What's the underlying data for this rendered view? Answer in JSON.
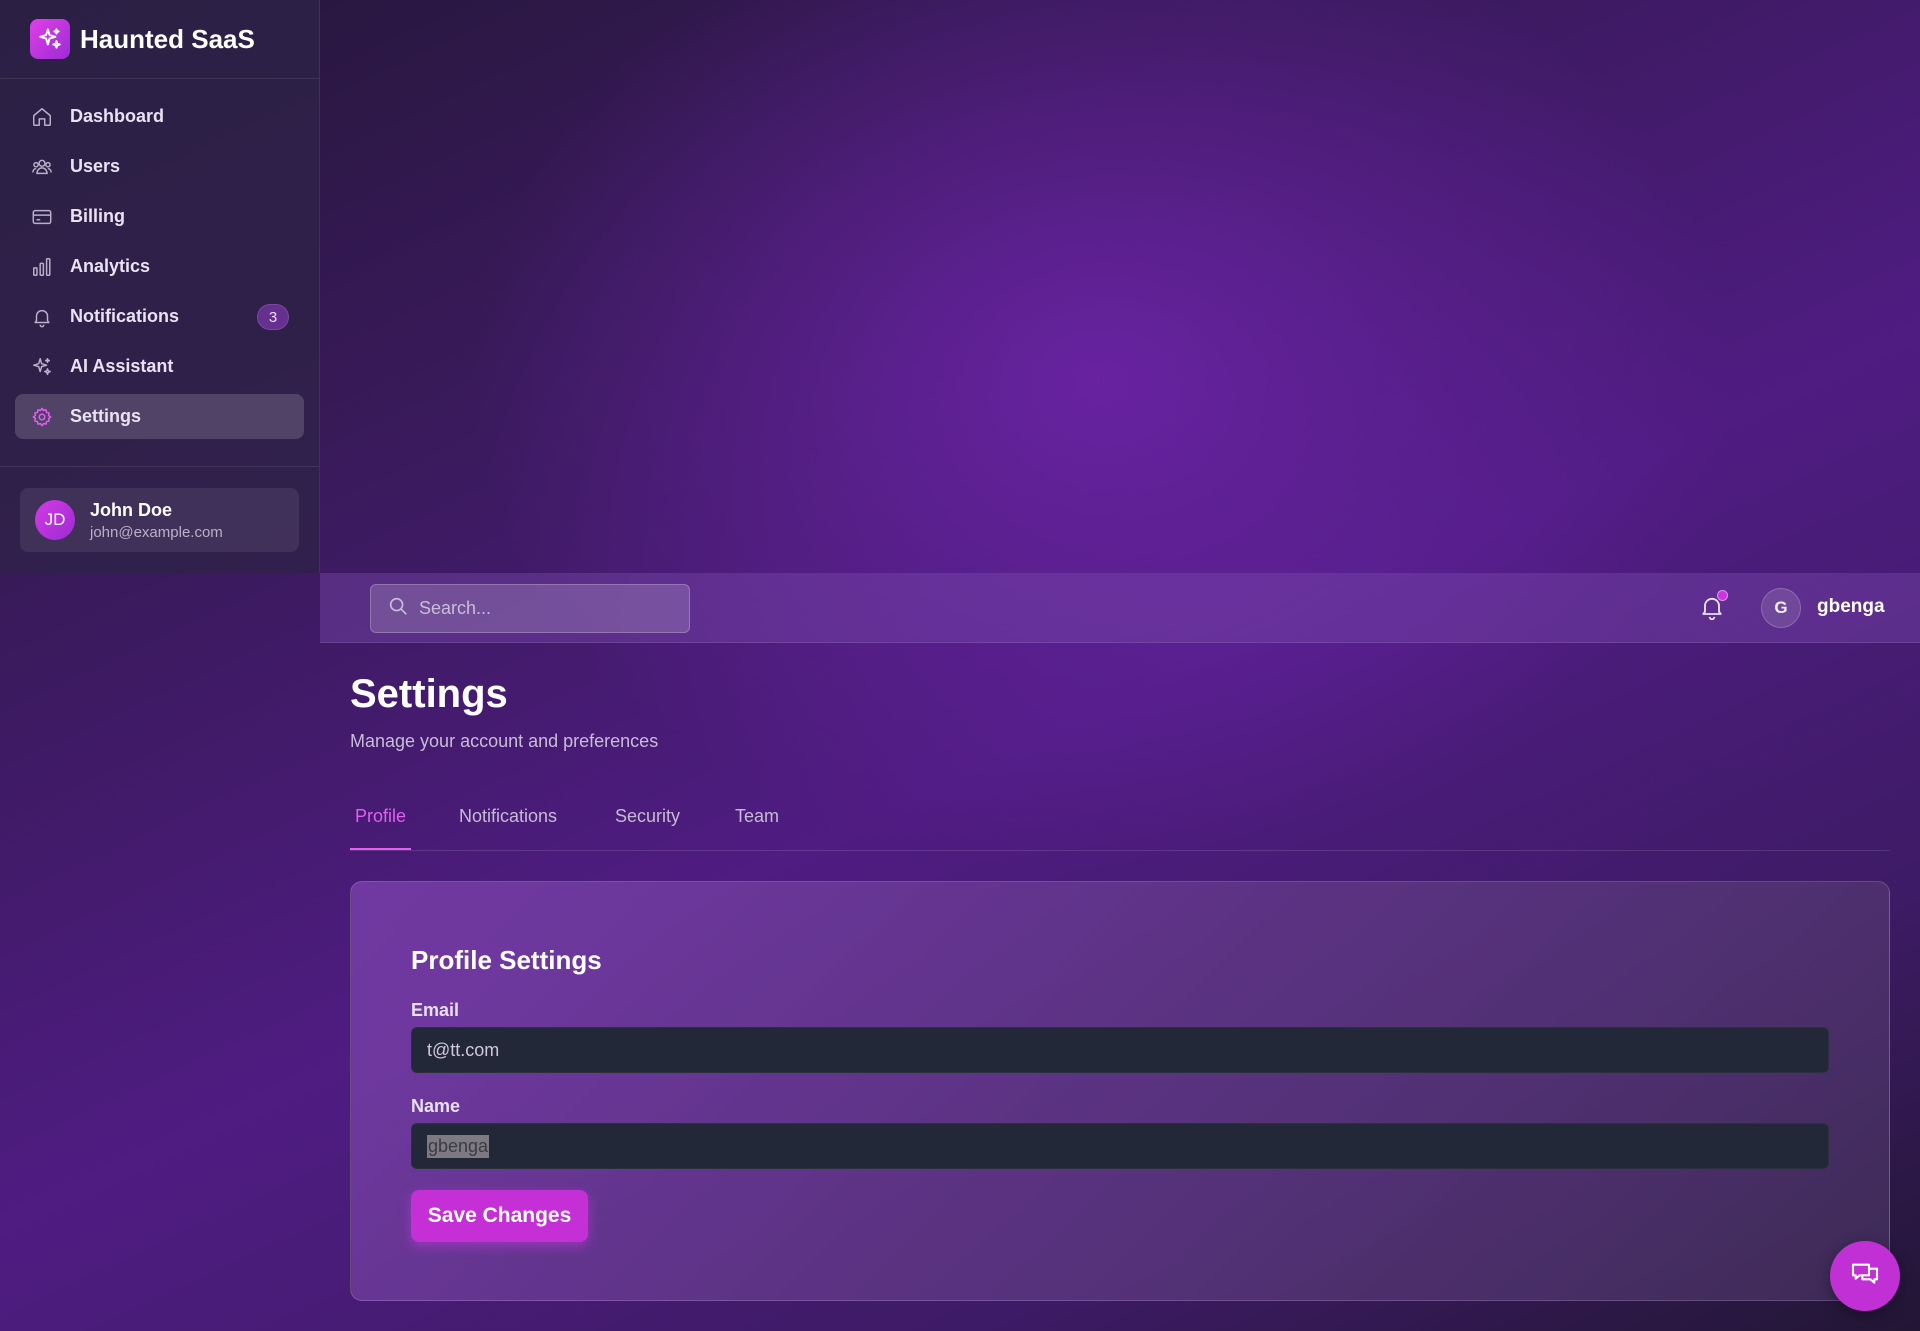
{
  "brand": {
    "name": "Haunted SaaS",
    "icon": "sparkles-icon"
  },
  "sidebar": {
    "items": [
      {
        "label": "Dashboard",
        "icon": "home-icon"
      },
      {
        "label": "Users",
        "icon": "users-icon"
      },
      {
        "label": "Billing",
        "icon": "credit-card-icon"
      },
      {
        "label": "Analytics",
        "icon": "bar-chart-icon"
      },
      {
        "label": "Notifications",
        "icon": "bell-icon",
        "badge": "3"
      },
      {
        "label": "AI Assistant",
        "icon": "sparkles-icon"
      },
      {
        "label": "Settings",
        "icon": "gear-icon",
        "active": true
      }
    ],
    "user": {
      "initials": "JD",
      "name": "John Doe",
      "email": "john@example.com"
    }
  },
  "topbar": {
    "search_placeholder": "Search...",
    "avatar_initial": "G",
    "username": "gbenga"
  },
  "page": {
    "title": "Settings",
    "subtitle": "Manage your account and preferences"
  },
  "tabs": [
    {
      "label": "Profile",
      "active": true
    },
    {
      "label": "Notifications"
    },
    {
      "label": "Security"
    },
    {
      "label": "Team"
    }
  ],
  "profile": {
    "title": "Profile Settings",
    "email_label": "Email",
    "email_value": "t@tt.com",
    "name_label": "Name",
    "name_value": "gbenga",
    "save_label": "Save Changes"
  },
  "colors": {
    "accent": "#c42fd6",
    "active_tab": "#e45ef0",
    "input_bg": "#232838"
  }
}
